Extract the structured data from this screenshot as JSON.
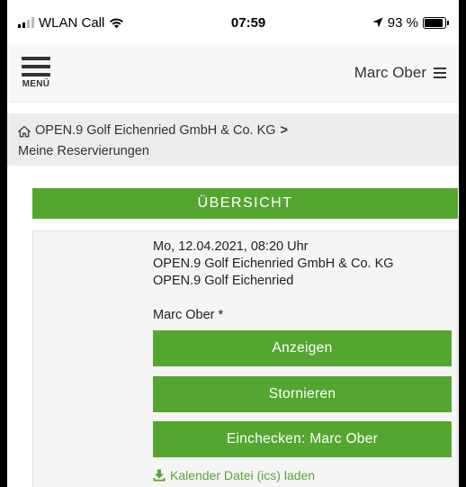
{
  "status_bar": {
    "carrier": "WLAN Call",
    "time": "07:59",
    "battery": "93 %",
    "battery_level": 0.93
  },
  "top_nav": {
    "menu_label": "MENÜ",
    "user_name": "Marc Ober"
  },
  "breadcrumb": {
    "parent": "OPEN.9 Golf Eichenried GmbH & Co. KG",
    "separator": ">",
    "current": "Meine Reservierungen"
  },
  "overview": {
    "title": "ÜBERSICHT"
  },
  "reservation": {
    "datetime": "Mo, 12.04.2021, 08:20 Uhr",
    "club": "OPEN.9 Golf Eichenried GmbH & Co. KG",
    "course": "OPEN.9 Golf Eichenried",
    "booker": "Marc Ober *",
    "show_label": "Anzeigen",
    "cancel_label": "Stornieren",
    "checkin_label": "Einchecken: Marc Ober",
    "ics_label": "Kalender Datei (ics) laden"
  },
  "colors": {
    "accent_green": "#55a631",
    "breadcrumb_bg": "#ececec"
  },
  "icons": [
    "wifi-icon",
    "location-arrow-icon",
    "battery-icon",
    "menu-icon",
    "user-menu-icon",
    "home-icon",
    "download-icon"
  ]
}
